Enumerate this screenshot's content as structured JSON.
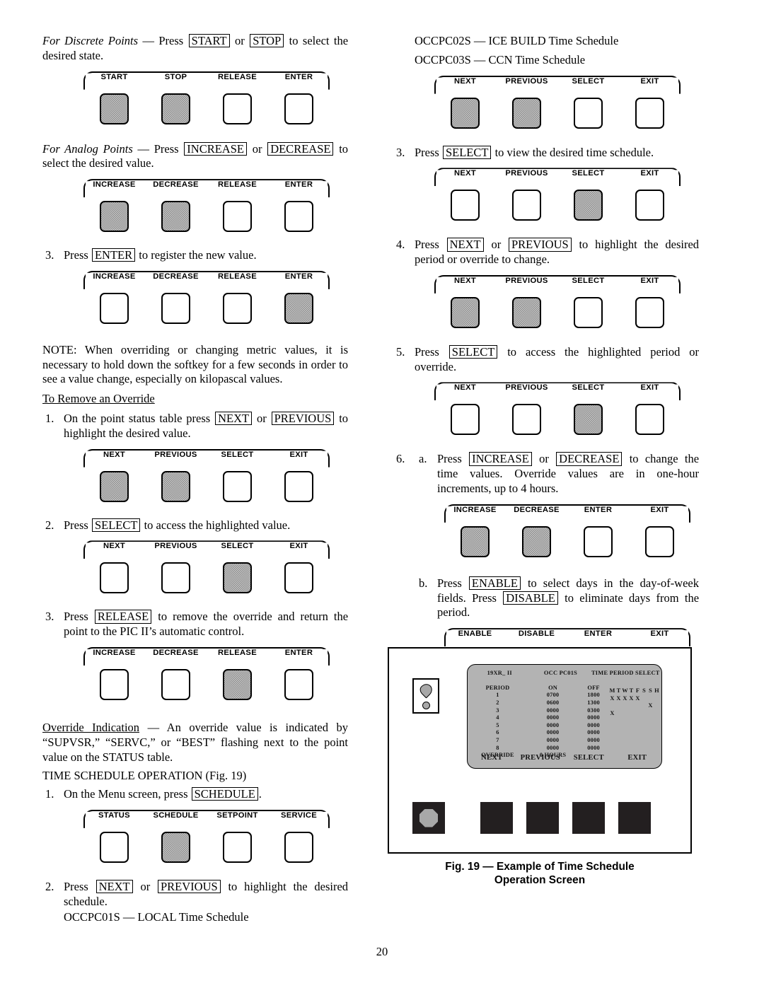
{
  "page": {
    "number": "20"
  },
  "left_column": {
    "discrete_points": {
      "lead_italic": "For Discrete Points",
      "dash": "—",
      "press": "Press",
      "key1": "START",
      "or": "or",
      "key2": "STOP",
      "tail": "to select the desired state."
    },
    "softkeys_1": {
      "labels": [
        "START",
        "STOP",
        "RELEASE",
        "ENTER"
      ],
      "highlighted": [
        true,
        true,
        false,
        false
      ]
    },
    "analog_points": {
      "lead_italic": "For Analog Points",
      "dash": "—",
      "press": "Press",
      "key1": "INCREASE",
      "or": "or",
      "key2": "DECREASE",
      "tail": "to select the desired value."
    },
    "softkeys_2": {
      "labels": [
        "INCREASE",
        "DECREASE",
        "RELEASE",
        "ENTER"
      ],
      "highlighted": [
        true,
        true,
        false,
        false
      ]
    },
    "step_3": {
      "num": "3.",
      "press": "Press",
      "key1": "ENTER",
      "tail": "to register the new value."
    },
    "softkeys_3": {
      "labels": [
        "INCREASE",
        "DECREASE",
        "RELEASE",
        "ENTER"
      ],
      "highlighted": [
        false,
        false,
        false,
        true
      ]
    },
    "note": "NOTE: When overriding or changing metric values, it is necessary to hold down the softkey for a few seconds in order to see a value change, especially on kilopascal values.",
    "remove_override_heading": "To Remove an Override",
    "remove_step_1": {
      "num": "1.",
      "pre": "On the point status table press",
      "key1": "NEXT",
      "or": "or",
      "key2": "PREVIOUS",
      "tail": "to highlight the desired value."
    },
    "softkeys_4": {
      "labels": [
        "NEXT",
        "PREVIOUS",
        "SELECT",
        "EXIT"
      ],
      "highlighted": [
        true,
        true,
        false,
        false
      ]
    },
    "remove_step_2": {
      "num": "2.",
      "pre": "Press",
      "key1": "SELECT",
      "tail": "to access the highlighted value."
    },
    "softkeys_5": {
      "labels": [
        "NEXT",
        "PREVIOUS",
        "SELECT",
        "EXIT"
      ],
      "highlighted": [
        false,
        false,
        true,
        false
      ]
    },
    "remove_step_3": {
      "num": "3.",
      "pre": "Press",
      "key1": "RELEASE",
      "tail": "to remove the override and return the point to the PIC II’s automatic control."
    },
    "softkeys_6": {
      "labels": [
        "INCREASE",
        "DECREASE",
        "RELEASE",
        "ENTER"
      ],
      "highlighted": [
        false,
        false,
        true,
        false
      ]
    },
    "override_indication": {
      "heading": "Override Indication",
      "dash": "—",
      "body": "An override value is indicated by “SUPVSR,” “SERVC,” or “BEST” flashing next to the point value on the STATUS table."
    },
    "time_schedule_heading": "TIME SCHEDULE OPERATION (Fig. 19)",
    "ts_step_1": {
      "num": "1.",
      "pre": "On the Menu screen, press",
      "key1": "SCHEDULE",
      "tail": "."
    },
    "softkeys_7": {
      "labels": [
        "STATUS",
        "SCHEDULE",
        "SETPOINT",
        "SERVICE"
      ],
      "highlighted": [
        false,
        true,
        false,
        false
      ]
    },
    "ts_step_2": {
      "num": "2.",
      "pre": "Press",
      "key1": "NEXT",
      "or": "or",
      "key2": "PREVIOUS",
      "tail": "to highlight the desired schedule."
    },
    "schedule_list_1": "OCCPC01S — LOCAL Time Schedule"
  },
  "right_column": {
    "schedule_list_2": "OCCPC02S — ICE BUILD Time Schedule",
    "schedule_list_3": "OCCPC03S — CCN Time Schedule",
    "softkeys_8": {
      "labels": [
        "NEXT",
        "PREVIOUS",
        "SELECT",
        "EXIT"
      ],
      "highlighted": [
        true,
        true,
        false,
        false
      ]
    },
    "ts_step_3": {
      "num": "3.",
      "pre": "Press",
      "key1": "SELECT",
      "tail": "to view the desired time schedule."
    },
    "softkeys_9": {
      "labels": [
        "NEXT",
        "PREVIOUS",
        "SELECT",
        "EXIT"
      ],
      "highlighted": [
        false,
        false,
        true,
        false
      ]
    },
    "ts_step_4": {
      "num": "4.",
      "pre": "Press",
      "key1": "NEXT",
      "or": "or",
      "key2": "PREVIOUS",
      "tail": "to highlight the desired period or override to change."
    },
    "softkeys_10": {
      "labels": [
        "NEXT",
        "PREVIOUS",
        "SELECT",
        "EXIT"
      ],
      "highlighted": [
        true,
        true,
        false,
        false
      ]
    },
    "ts_step_5": {
      "num": "5.",
      "pre": "Press",
      "key1": "SELECT",
      "tail": "to access the highlighted period or override."
    },
    "softkeys_11": {
      "labels": [
        "NEXT",
        "PREVIOUS",
        "SELECT",
        "EXIT"
      ],
      "highlighted": [
        false,
        false,
        true,
        false
      ]
    },
    "ts_step_6a": {
      "num": "6.",
      "alpha": "a.",
      "pre": "Press",
      "key1": "INCREASE",
      "or": "or",
      "key2": "DECREASE",
      "tail": "to change the time values. Override values are in one-hour increments, up to 4 hours."
    },
    "softkeys_12": {
      "labels": [
        "INCREASE",
        "DECREASE",
        "ENTER",
        "EXIT"
      ],
      "highlighted": [
        true,
        true,
        false,
        false
      ]
    },
    "ts_step_6b": {
      "alpha": "b.",
      "pre": "Press",
      "key1": "ENABLE",
      "mid": "to select days in the day-of-week fields. Press",
      "key2": "DISABLE",
      "tail": "to eliminate days from the period."
    },
    "softkeys_13": {
      "labels": [
        "ENABLE",
        "DISABLE",
        "ENTER",
        "EXIT"
      ],
      "highlighted": [
        true,
        true,
        false,
        false
      ]
    }
  },
  "figure": {
    "caption_line1": "Fig. 19 — Example of Time Schedule",
    "caption_line2": "Operation Screen",
    "alarm_icon_name": "alarm-exclamation-icon",
    "screen": {
      "header": [
        "19XR_ II",
        "OCC PC01S",
        "TIME PERIOD SELECT"
      ],
      "column_headers": {
        "period": "PERIOD",
        "on": "ON",
        "off": "OFF",
        "days": [
          "M",
          "T",
          "W",
          "T",
          "F",
          "S",
          "S",
          "H"
        ]
      },
      "rows": [
        {
          "period": "1",
          "on": "0700",
          "off": "1800",
          "days": [
            true,
            true,
            true,
            true,
            true,
            false,
            false,
            false
          ]
        },
        {
          "period": "2",
          "on": "0600",
          "off": "1300",
          "days": [
            false,
            false,
            false,
            false,
            false,
            false,
            true,
            false
          ]
        },
        {
          "period": "3",
          "on": "0000",
          "off": "0300",
          "days": [
            true,
            false,
            false,
            false,
            false,
            false,
            false,
            false
          ]
        },
        {
          "period": "4",
          "on": "0000",
          "off": "0000",
          "days": [
            false,
            false,
            false,
            false,
            false,
            false,
            false,
            false
          ]
        },
        {
          "period": "5",
          "on": "0000",
          "off": "0000",
          "days": [
            false,
            false,
            false,
            false,
            false,
            false,
            false,
            false
          ]
        },
        {
          "period": "6",
          "on": "0000",
          "off": "0000",
          "days": [
            false,
            false,
            false,
            false,
            false,
            false,
            false,
            false
          ]
        },
        {
          "period": "7",
          "on": "0000",
          "off": "0000",
          "days": [
            false,
            false,
            false,
            false,
            false,
            false,
            false,
            false
          ]
        },
        {
          "period": "8",
          "on": "0000",
          "off": "0000",
          "days": [
            false,
            false,
            false,
            false,
            false,
            false,
            false,
            false
          ]
        }
      ],
      "override": {
        "label": "OVERRIDE",
        "value": "0 HOURS"
      },
      "softkeys": [
        "NEXT",
        "PREVIOUS",
        "SELECT",
        "EXIT"
      ],
      "day_marker": "X"
    },
    "panel_buttons": [
      "stop-button",
      "softkey-1",
      "softkey-2",
      "softkey-3",
      "softkey-4"
    ]
  }
}
